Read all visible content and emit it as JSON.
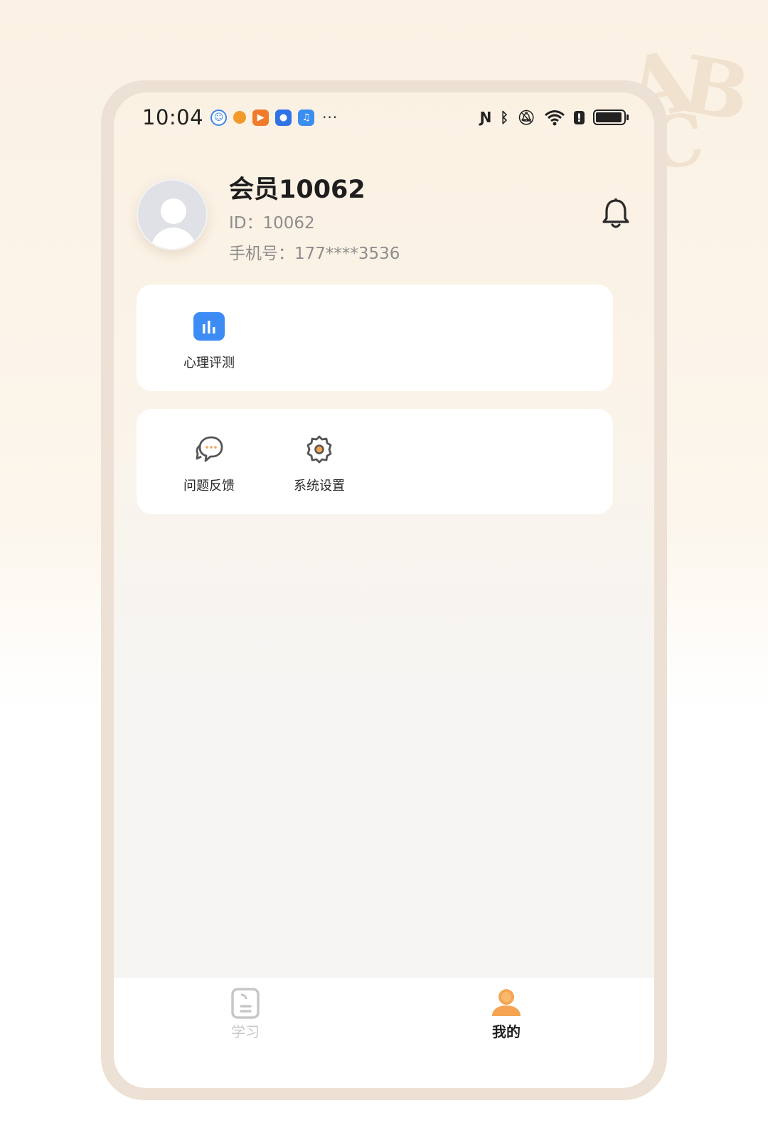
{
  "status_bar": {
    "time": "10:04",
    "dots": "···"
  },
  "profile": {
    "name": "会员10062",
    "id_text": "ID：10062",
    "phone_text": "手机号：177****3536"
  },
  "card_1": {
    "items": [
      {
        "label": "心理评测",
        "icon": "bar-chart-icon",
        "color": "#3d8cf5"
      }
    ]
  },
  "card_2": {
    "items": [
      {
        "label": "问题反馈",
        "icon": "chat-bubble-icon"
      },
      {
        "label": "系统设置",
        "icon": "gear-icon"
      }
    ]
  },
  "tabbar": {
    "tabs": [
      {
        "label": "学习",
        "icon": "book-icon",
        "active": false
      },
      {
        "label": "我的",
        "icon": "user-icon",
        "active": true
      }
    ],
    "active_color": "#f5a552"
  }
}
